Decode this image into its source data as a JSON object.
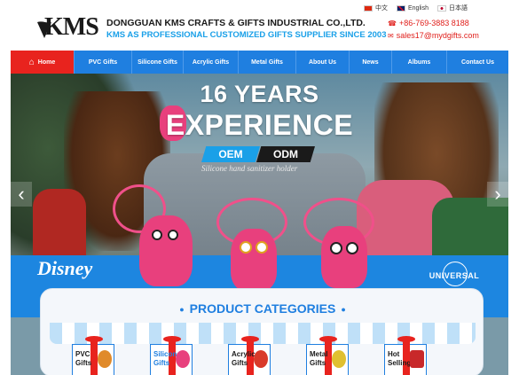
{
  "header": {
    "logo_text": "KMS",
    "company_name": "DONGGUAN KMS CRAFTS & GIFTS INDUSTRIAL CO.,LTD.",
    "tagline": "KMS AS PROFESSIONAL CUSTOMIZED GIFTS SUPPLIER SINCE 2003",
    "languages": [
      {
        "label": "中文",
        "flag": "flag-cn"
      },
      {
        "label": "English",
        "flag": "flag-uk"
      },
      {
        "label": "日本語",
        "flag": "flag-jp"
      }
    ],
    "phone": "+86-769-3883 8188",
    "email": "sales17@mydgifts.com",
    "phone_icon": "phone-icon",
    "email_icon": "mail-icon"
  },
  "nav": {
    "items": [
      {
        "label": "Home",
        "active": true
      },
      {
        "label": "PVC Gifts"
      },
      {
        "label": "Silicone Gifts"
      },
      {
        "label": "Acrylic Gifts"
      },
      {
        "label": "Metal Gifts"
      },
      {
        "label": "About Us"
      },
      {
        "label": "News"
      },
      {
        "label": "Albums"
      },
      {
        "label": "Contact Us"
      }
    ],
    "colors": {
      "bar": "#1f7fe0",
      "active": "#e8231e"
    }
  },
  "banner": {
    "headline": "16 YEARS",
    "headline2": "EXPERIENCE",
    "badge_oem": "OEM",
    "badge_odm": "ODM",
    "caption": "Silicone hand sanitizer holder",
    "brand_left": "Disney",
    "brand_right": "UNIVERSAL",
    "prev_icon": "chevron-left-icon",
    "next_icon": "chevron-right-icon"
  },
  "categories": {
    "title": "PRODUCT CATEGORIES",
    "items": [
      {
        "label": "PVC Gifts"
      },
      {
        "label": "Silicone Gifts"
      },
      {
        "label": "Acrylic Gifts"
      },
      {
        "label": "Metal Gifts"
      },
      {
        "label": "Hot Selling"
      }
    ]
  }
}
